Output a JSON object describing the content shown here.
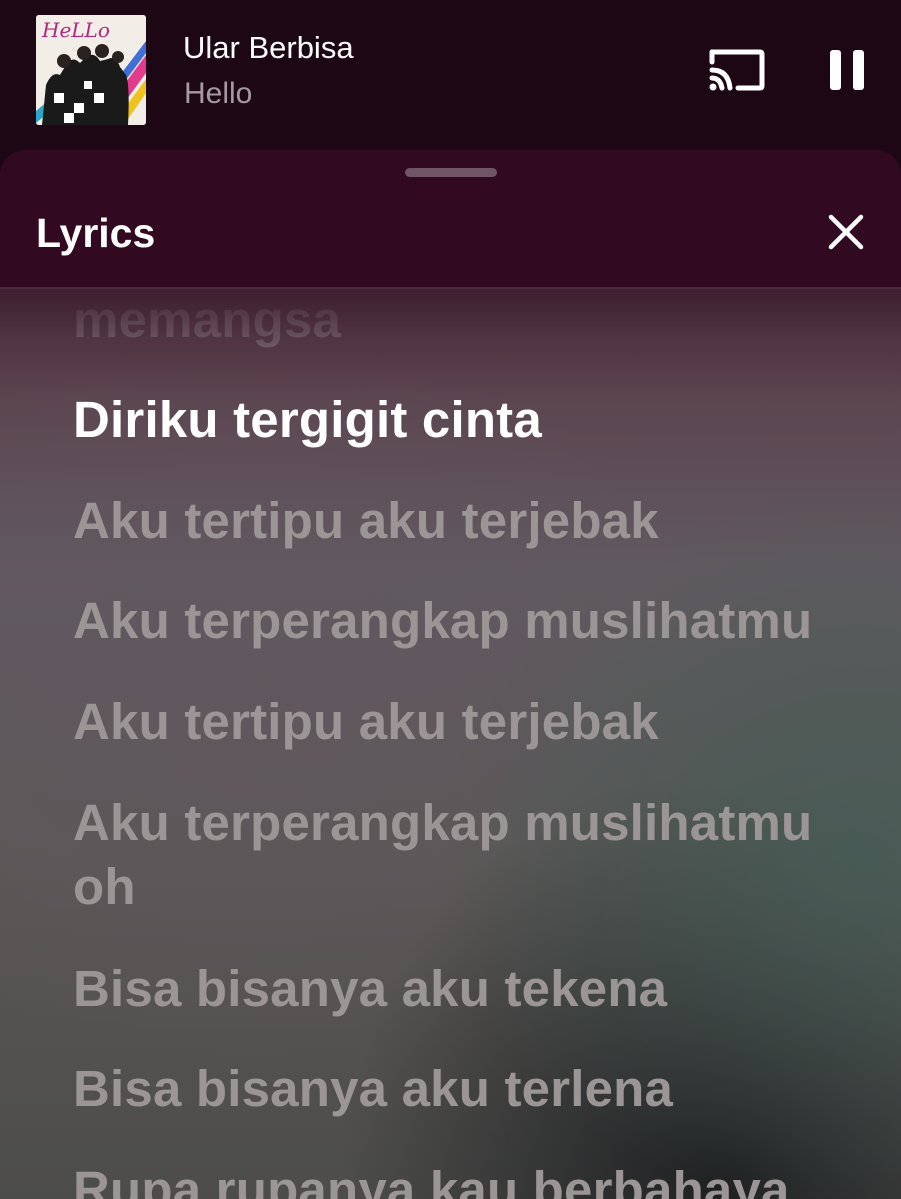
{
  "mini_player": {
    "album_art_text": "HeLLo",
    "track_title": "Ular Berbisa",
    "artist": "Hello",
    "cast_icon": "cast-icon",
    "pause_icon": "pause-icon"
  },
  "lyrics_sheet": {
    "title": "Lyrics",
    "close_icon": "close-icon",
    "lines": [
      {
        "text": "memangsa",
        "state": "past"
      },
      {
        "text": "Diriku tergigit cinta",
        "state": "current"
      },
      {
        "text": "Aku tertipu aku terjebak",
        "state": "upcoming"
      },
      {
        "text": "Aku terperangkap muslihatmu",
        "state": "upcoming"
      },
      {
        "text": "Aku tertipu aku terjebak",
        "state": "upcoming"
      },
      {
        "text": "Aku terperangkap muslihatmu oh",
        "state": "upcoming"
      },
      {
        "text": "Bisa bisanya aku tekena",
        "state": "upcoming"
      },
      {
        "text": "Bisa bisanya aku terlena",
        "state": "upcoming"
      },
      {
        "text": "Rupa rupanya kau berbahaya",
        "state": "upcoming"
      }
    ]
  },
  "colors": {
    "background": "#1e0714",
    "sheet_header": "#310a21",
    "lyric_current": "#ffffff",
    "lyric_upcoming": "#9c9596",
    "artist_text": "#a69aa2"
  }
}
